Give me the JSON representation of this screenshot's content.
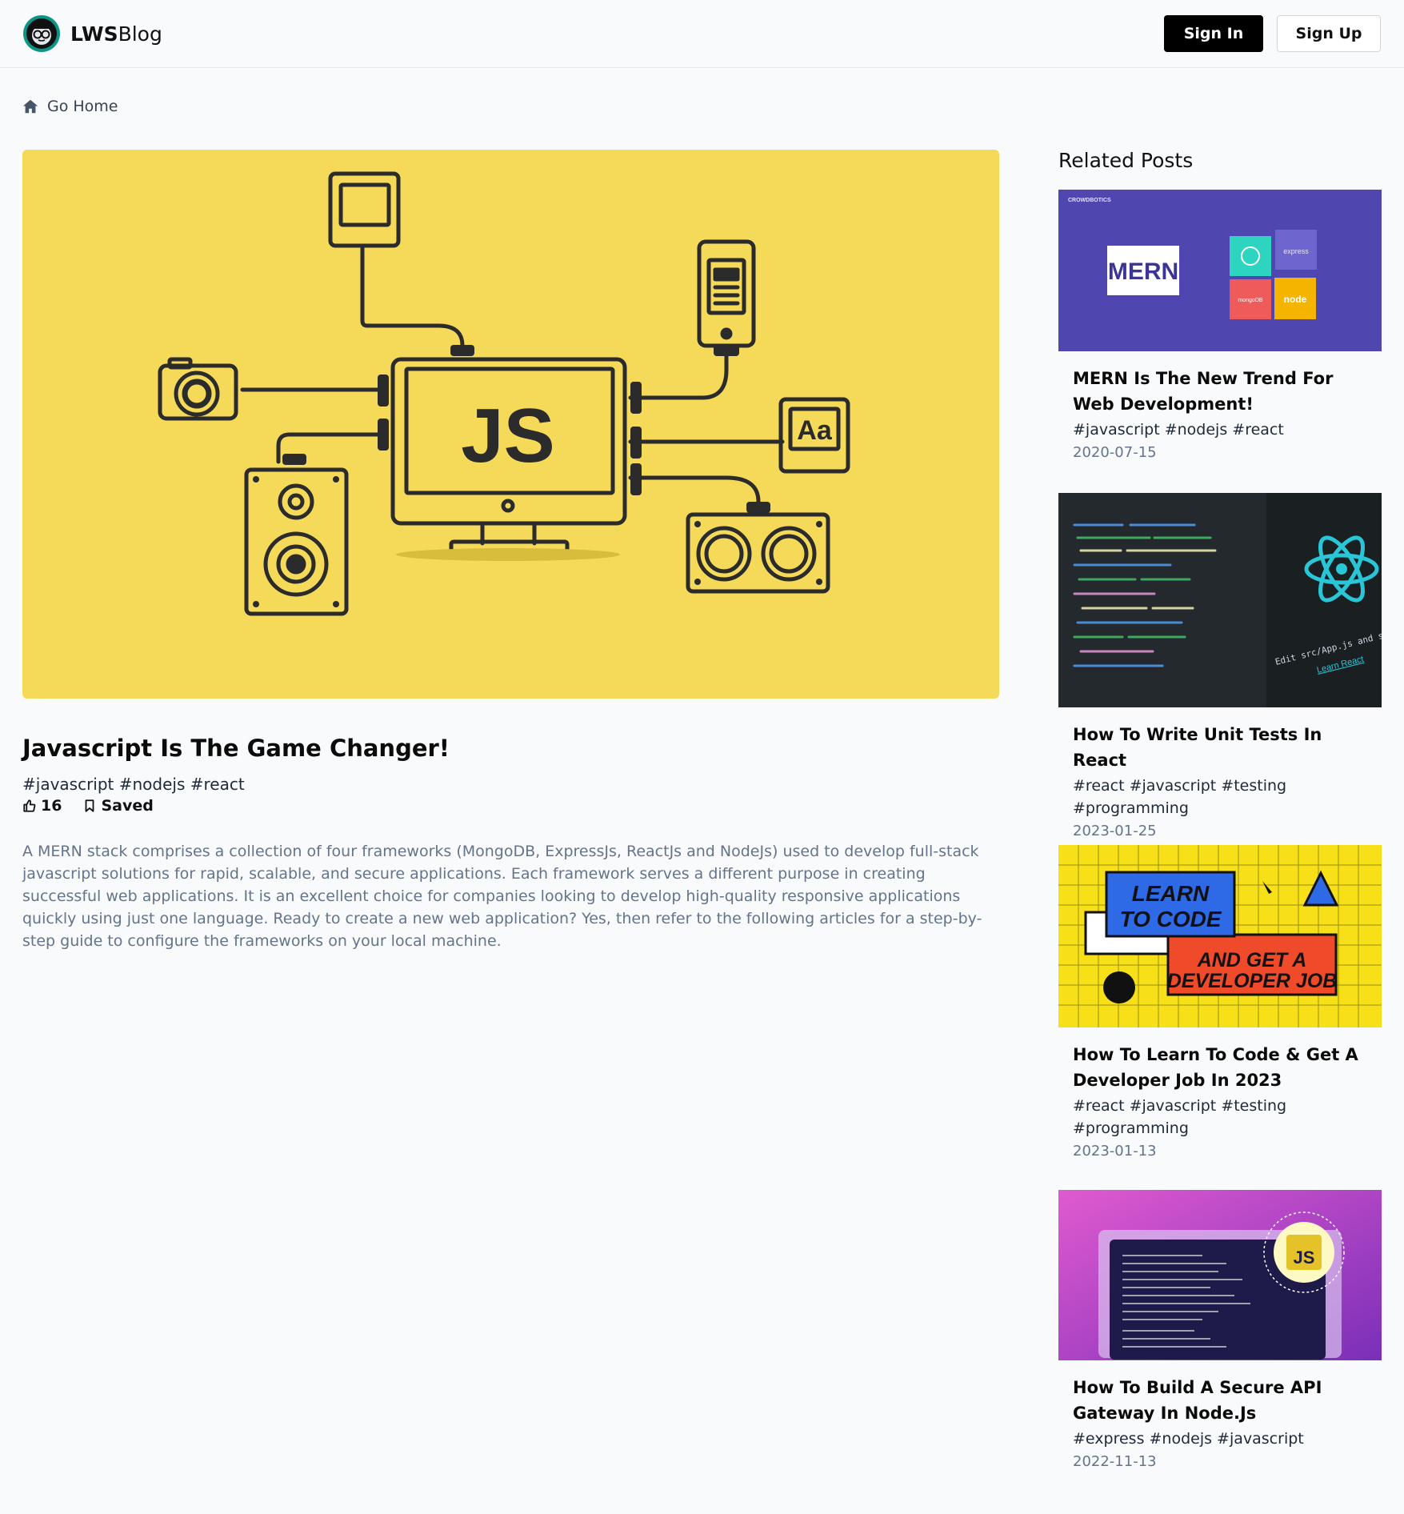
{
  "brand": {
    "strong": "LWS",
    "rest": "Blog"
  },
  "nav": {
    "sign_in": "Sign In",
    "sign_up": "Sign Up"
  },
  "go_home": "Go Home",
  "post": {
    "image_label": "JS",
    "title": "Javascript Is The Game Changer!",
    "tags": "#javascript #nodejs #react",
    "likes": "16",
    "saved": "Saved",
    "description": "A MERN stack comprises a collection of four frameworks (MongoDB, ExpressJs, ReactJs and NodeJs) used to develop full-stack javascript solutions for rapid, scalable, and secure applications. Each framework serves a different purpose in creating successful web applications. It is an excellent choice for companies looking to develop high-quality responsive applications quickly using just one language. Ready to create a new web application? Yes, then refer to the following articles for a step-by-step guide to configure the frameworks on your local machine."
  },
  "related": {
    "heading": "Related Posts",
    "posts": [
      {
        "title": "MERN Is The New Trend For Web Development!",
        "tags": "#javascript #nodejs #react",
        "date": "2020-07-15",
        "thumb": {
          "brand": "CROWDBOTICS",
          "badge": "MERN",
          "express": "express",
          "mongo": "mongoDB",
          "node": "node"
        }
      },
      {
        "title": "How To Write Unit Tests In React",
        "tags": "#react #javascript #testing #programming",
        "date": "2023-01-25",
        "thumb": {
          "caption": "Edit src/App.js and save to reload.",
          "link": "Learn React"
        }
      },
      {
        "title": "How To Learn To Code & Get A Developer Job In 2023",
        "tags": "#react #javascript #testing #programming",
        "date": "2023-01-13",
        "thumb": {
          "line1": "LEARN",
          "line2": "TO CODE",
          "line3": "AND GET A",
          "line4": "DEVELOPER JOB"
        }
      },
      {
        "title": "How To Build A Secure API Gateway In Node.Js",
        "tags": "#express #nodejs #javascript",
        "date": "2022-11-13",
        "thumb": {
          "badge": "JS"
        }
      }
    ]
  },
  "colors": {
    "hero_bg": "#f5d958",
    "card1_bg": "#5046b0",
    "card3_bg": "#f7e018",
    "accent_black": "#000000",
    "logo_ring": "#0d9488"
  }
}
